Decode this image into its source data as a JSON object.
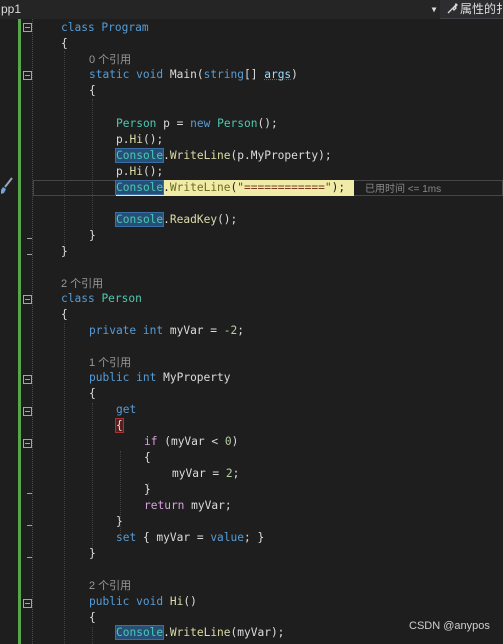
{
  "toolbar": {
    "project": "pp1",
    "properties": "属性的扌"
  },
  "perf_tip": "已用时间 <= 1ms",
  "watermark": "CSDN @anypos",
  "code": {
    "l1": "class Program",
    "l2": "{",
    "l3": "0 个引用",
    "l4": {
      "kw1": "static",
      "kw2": "void",
      "name": "Main",
      "open": "(",
      "kw3": "string",
      "arr": "[] ",
      "param": "args",
      "close": ")"
    },
    "l5": "{",
    "l7": {
      "cls": "Person",
      "mid": " p = ",
      "kw": "new",
      "cls2": "Person",
      "end": "();"
    },
    "l8": {
      "obj": "p.",
      "fn": "Hi",
      "end": "();"
    },
    "l9": {
      "cls": "Console",
      "dot": ".",
      "fn": "WriteLine",
      "arg": "(p.MyProperty);"
    },
    "l10": {
      "obj": "p.",
      "fn": "Hi",
      "end": "();"
    },
    "l11": {
      "cls": "Console",
      "dot": ".",
      "fn": "WriteLine",
      "open": "(",
      "str": "\"============\"",
      "end": ");"
    },
    "l13": {
      "cls": "Console",
      "dot": ".",
      "fn": "ReadKey",
      "end": "();"
    },
    "l14": "}",
    "l15": "}",
    "l17": "2 个引用",
    "l18": {
      "kw": "class",
      "cls": "Person"
    },
    "l19": "{",
    "l20": {
      "kw1": "private",
      "kw2": "int",
      "rest": " myVar = ",
      "num": "-2",
      "end": ";"
    },
    "l22": "1 个引用",
    "l23": {
      "kw1": "public",
      "kw2": "int",
      "name": " MyProperty"
    },
    "l24": "{",
    "l25": "get",
    "l26": "{",
    "l27": {
      "kw": "if",
      "rest": " (myVar < ",
      "num": "0",
      "end": ")"
    },
    "l28": "{",
    "l29": {
      "rest": "myVar = ",
      "num": "2",
      "end": ";"
    },
    "l30": "}",
    "l31": {
      "kw": "return",
      "rest": " myVar;"
    },
    "l32": "}",
    "l33": {
      "kw": "set",
      "open": " { myVar = ",
      "kw2": "value",
      "end": "; }"
    },
    "l34": "}",
    "l36": "2 个引用",
    "l37": {
      "kw1": "public",
      "kw2": "void",
      "fn": " Hi",
      "end": "()"
    },
    "l38": "{",
    "l39": {
      "cls": "Console",
      "dot": ".",
      "fn": "WriteLine",
      "arg": "(myVar);"
    }
  }
}
